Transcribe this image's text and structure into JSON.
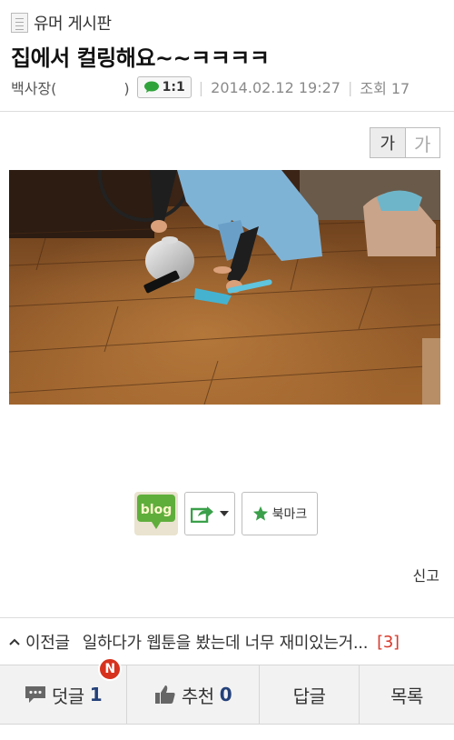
{
  "board": {
    "name": "유머 게시판",
    "icon": "document-icon"
  },
  "post": {
    "title": "집에서 컬링해요~~ㅋㅋㅋㅋ",
    "author": "백사장(",
    "author_close": ")",
    "chat_label": "1:1",
    "date": "2014.02.12 19:27",
    "views": "조회 17"
  },
  "font_size": {
    "small": "가",
    "large": "가"
  },
  "photo": {
    "icon": "photo"
  },
  "actions": {
    "blog": "blog",
    "share_icon": "share-icon",
    "bookmark": "북마크"
  },
  "report": "신고",
  "prev_post": {
    "label": "이전글",
    "title": "일하다가 웹툰을 봤는데 너무 재미있는거...",
    "count": "[3]"
  },
  "bottom_tabs": {
    "comments_label": "덧글",
    "comments_count": "1",
    "new_badge": "N",
    "like_label": "추천",
    "like_count": "0",
    "reply_label": "답글",
    "list_label": "목록"
  },
  "colors": {
    "accent_count": "#24417a",
    "badge": "#d7321e",
    "reply_count": "#d8392a",
    "share_green": "#3aa04a"
  }
}
